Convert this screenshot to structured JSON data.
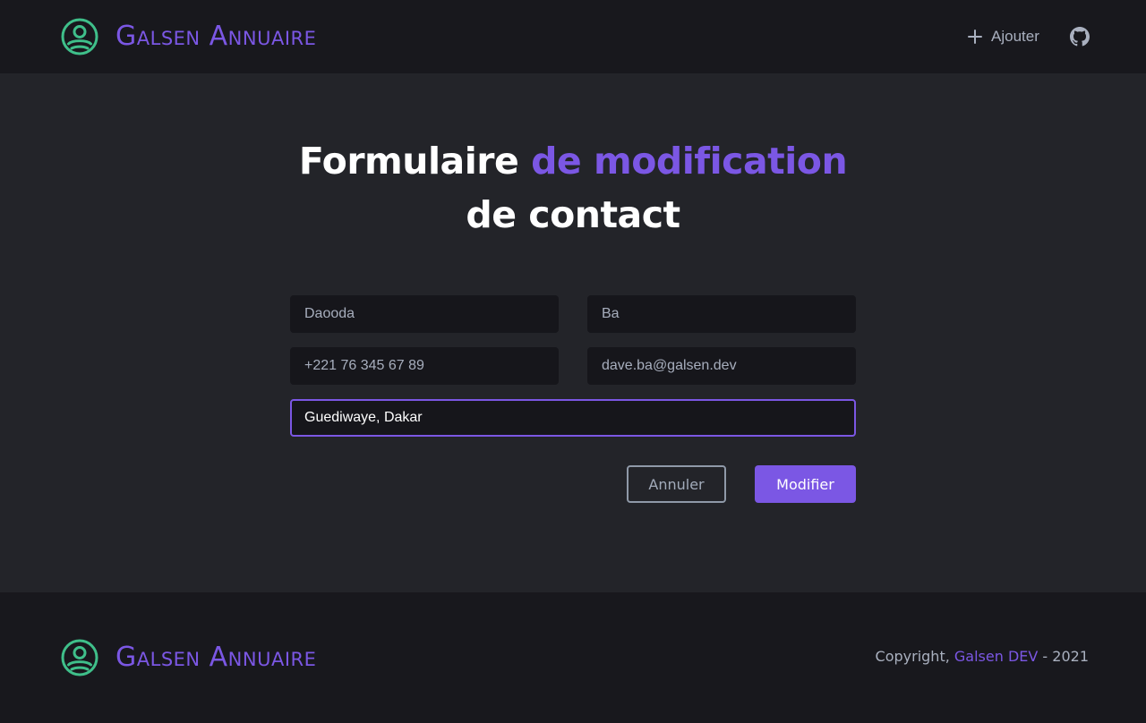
{
  "brand": {
    "name": "Galsen Annuaire",
    "logo_icon": "user-circle-icon",
    "logo_color": "#3fbf8a",
    "accent_color": "#7b57e4"
  },
  "nav": {
    "add_label": "Ajouter",
    "add_icon": "plus-icon",
    "github_icon": "github-icon"
  },
  "page": {
    "title_part1": "Formulaire",
    "title_accent": "de modification",
    "title_part2": "de contact"
  },
  "form": {
    "first_name": "Daooda",
    "last_name": "Ba",
    "phone": "+221 76 345 67 89",
    "email": "dave.ba@galsen.dev",
    "address": "Guediwaye, Dakar",
    "cancel_label": "Annuler",
    "submit_label": "Modifier"
  },
  "footer": {
    "copyright_prefix": "Copyright,",
    "copyright_org": "Galsen DEV",
    "copyright_suffix": "- 2021"
  }
}
